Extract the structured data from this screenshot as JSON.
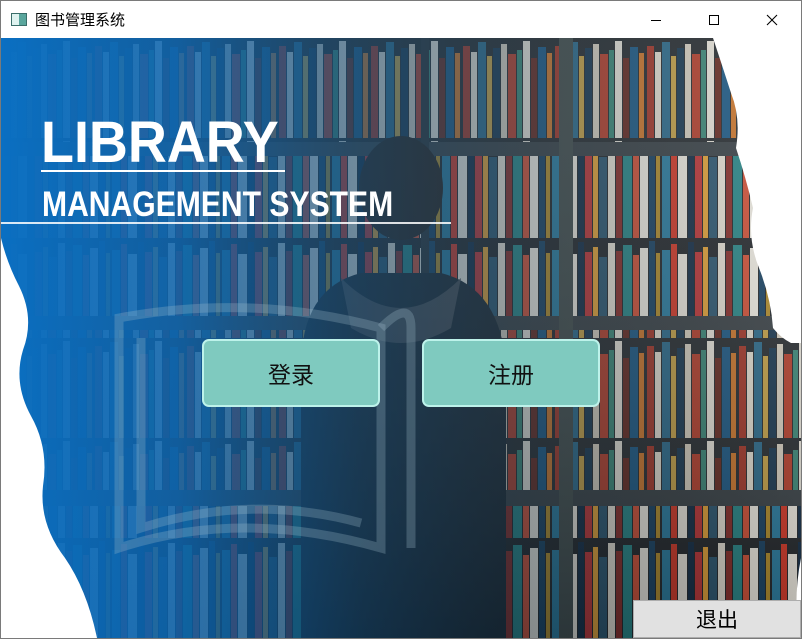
{
  "window": {
    "title": "图书管理系统",
    "app_icon": "window-app-icon",
    "controls": {
      "minimize": "minimize-icon",
      "maximize": "maximize-icon",
      "close": "close-icon"
    }
  },
  "logo": {
    "line1": "LIBRARY",
    "line2": "MANAGEMENT SYSTEM"
  },
  "actions": {
    "login_label": "登录",
    "register_label": "注册",
    "exit_label": "退出"
  },
  "colors": {
    "accent_button": "#7fcabf",
    "accent_button_border": "#bdf2ea",
    "brand_blue": "#0a74c4",
    "exit_button": "#e1e1e1"
  }
}
